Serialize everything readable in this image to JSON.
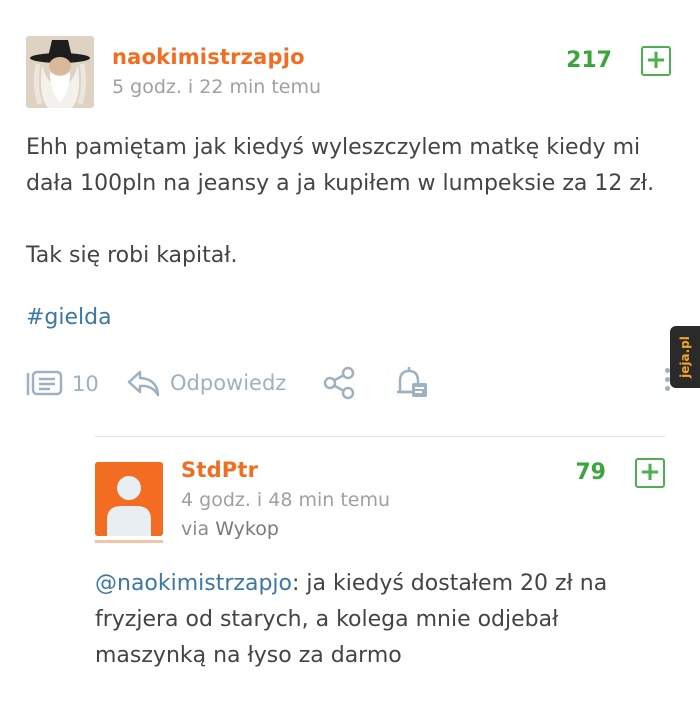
{
  "post": {
    "username": "naokimistrzapjo",
    "timestamp": "5 godz. i 22 min temu",
    "votes": "217",
    "vote_button": "+",
    "body_line1": "Ehh pamiętam jak kiedyś wyleszczylem matkę kiedy mi",
    "body_line2": "dała 100pln na jeansy a ja kupiłem w lumpeksie za 12 zł.",
    "body_line3": "Tak się robi kapitał.",
    "tag": "#gielda",
    "actions": {
      "comments_count": "10",
      "reply_label": "Odpowiedz"
    }
  },
  "reply": {
    "username": "StdPtr",
    "timestamp": "4 godz. i 48 min temu",
    "via_label": "via",
    "via_source": "Wykop",
    "votes": "79",
    "vote_button": "+",
    "mention": "@naokimistrzapjo",
    "body_line1_rest": ": ja kiedyś dostałem 20 zł na",
    "body_line2": "fryzjera od starych, a kolega mnie odjebał",
    "body_line3": "maszynką na łyso za darmo"
  },
  "watermark": "jeja.pl",
  "colors": {
    "username": "#f26d21",
    "votes": "#3aa53a",
    "link": "#3b78a6",
    "action": "#9eb1c2",
    "muted": "#a0a0a0"
  },
  "icons": [
    "wizard-avatar",
    "comments-icon",
    "reply-icon",
    "share-icon",
    "notification-bell-icon",
    "more-vertical-icon",
    "default-user-avatar"
  ]
}
